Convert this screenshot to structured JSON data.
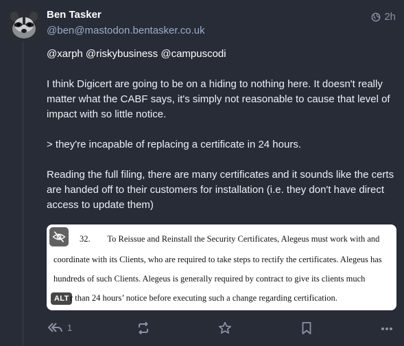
{
  "author": {
    "display_name": "Ben Tasker",
    "handle": "@ben@mastodon.bentasker.co.uk"
  },
  "timestamp": "2h",
  "post": {
    "mentions": "@xarph @riskybusiness @campuscodi",
    "paragraph1": "I think Digicert are going to be on a hiding to nothing here. It doesn't really matter what the CABF says, it's simply not reasonable to cause that level of impact with so little notice.",
    "paragraph2": "> they're incapable of replacing a certificate in 24 hours.",
    "paragraph3": "Reading the full filing, there are many certificates and it sounds like the certs are handed off to their customers for installation (i.e. they don't have direct access to update them)"
  },
  "media": {
    "line1": "32.        To Reissue and Reinstall the Security Certificates, Alegeus must work with and",
    "line2": "coordinate with its Clients, who are required to take steps to rectify the certificates. Alegeus has",
    "line3": "hundreds of such Clients. Alegeus is generally required by contract to give its clients much",
    "line4": "r than 24 hours’ notice before executing such a change regarding certification.",
    "alt_label": "ALT"
  },
  "actions": {
    "reply_count": "1"
  },
  "colors": {
    "background": "#282c37",
    "muted": "#8d93a6"
  }
}
